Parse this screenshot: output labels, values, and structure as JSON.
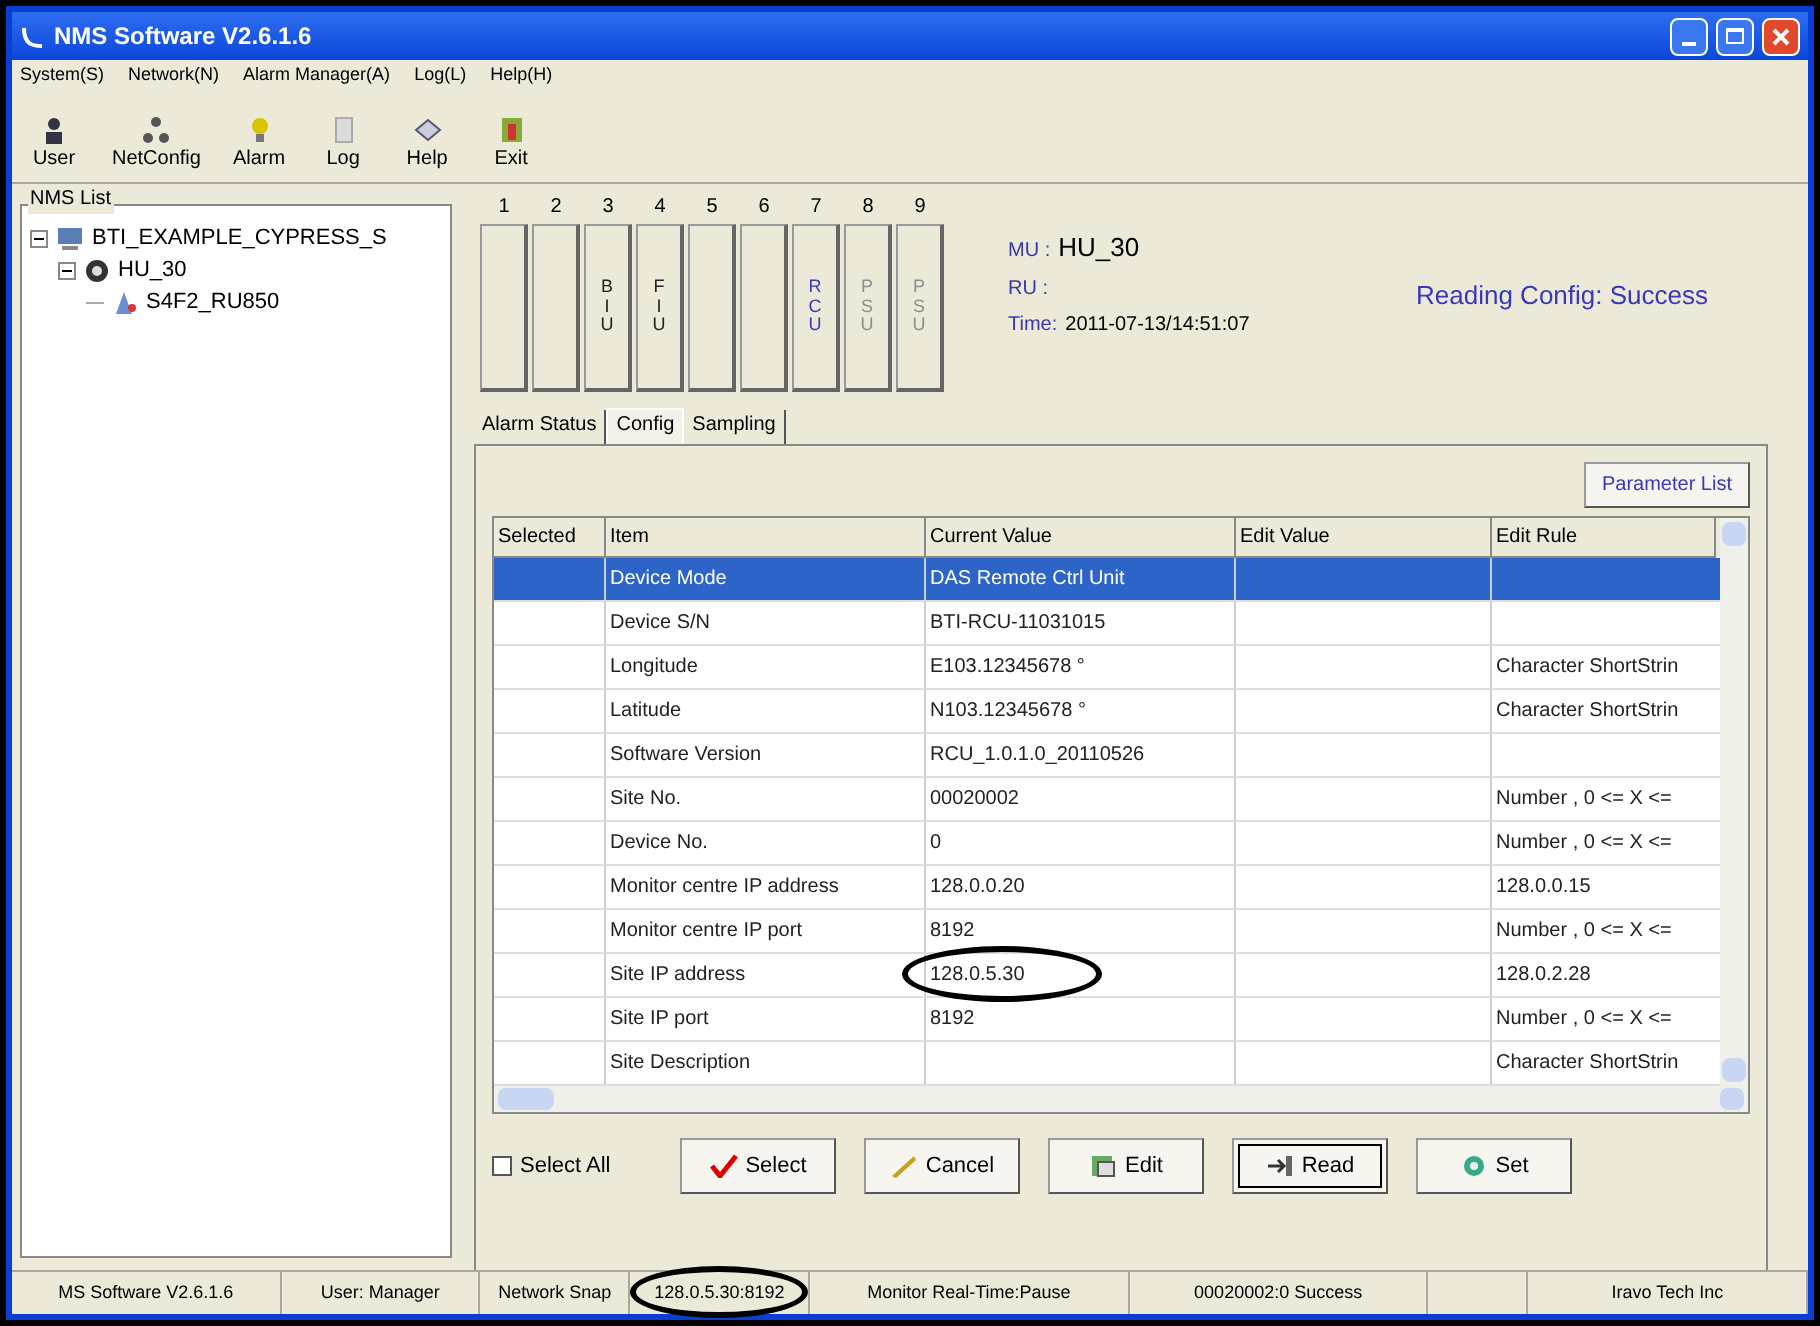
{
  "window": {
    "title": "NMS Software V2.6.1.6"
  },
  "menu": [
    "System(S)",
    "Network(N)",
    "Alarm Manager(A)",
    "Log(L)",
    "Help(H)"
  ],
  "toolbar": [
    {
      "label": "User",
      "kind": "user"
    },
    {
      "label": "NetConfig",
      "kind": "network"
    },
    {
      "label": "Alarm",
      "kind": "bulb"
    },
    {
      "label": "Log",
      "kind": "log"
    },
    {
      "label": "Help",
      "kind": "help"
    },
    {
      "label": "Exit",
      "kind": "exit"
    }
  ],
  "nms_list": {
    "title": "NMS List",
    "tree": [
      {
        "label": "BTI_EXAMPLE_CYPRESS_S",
        "kind": "computer",
        "expanded": true,
        "children": [
          {
            "label": "HU_30",
            "kind": "hub",
            "expanded": true,
            "children": [
              {
                "label": "S4F2_RU850",
                "kind": "remote"
              }
            ]
          }
        ]
      }
    ]
  },
  "slots": [
    {
      "number": "1",
      "kind": "normal"
    },
    {
      "number": "2",
      "kind": "normal"
    },
    {
      "number": "3",
      "label": "BIU",
      "kind": "normal"
    },
    {
      "number": "4",
      "label": "FIU",
      "kind": "normal"
    },
    {
      "number": "5",
      "kind": "normal"
    },
    {
      "number": "6",
      "kind": "normal"
    },
    {
      "number": "7",
      "label": "RCU",
      "kind": "active"
    },
    {
      "number": "8",
      "label": "PSU",
      "kind": "disabled"
    },
    {
      "number": "9",
      "label": "PSU",
      "kind": "disabled"
    }
  ],
  "info": {
    "mu_label": "MU :",
    "mu_value": "HU_30",
    "ru_label": "RU :",
    "time_label": "Time:",
    "time_value": "2011-07-13/14:51:07",
    "status": "Reading Config: Success"
  },
  "tabs": [
    {
      "label": "Alarm Status",
      "selected": false
    },
    {
      "label": "Config",
      "selected": true
    },
    {
      "label": "Sampling",
      "selected": false
    }
  ],
  "parameter_list_button": "Parameter List",
  "table": {
    "columns": [
      "Selected",
      "Item",
      "Current Value",
      "Edit Value",
      "Edit Rule"
    ],
    "rows": [
      {
        "item": "Device Mode",
        "current": "DAS Remote Ctrl Unit",
        "selected": true
      },
      {
        "item": "Device S/N",
        "current": "BTI-RCU-11031015",
        "selected": false
      },
      {
        "item": "Longitude",
        "current": "E103.12345678 °",
        "rule": "Character ShortStrin",
        "selected": false
      },
      {
        "item": "Latitude",
        "current": "N103.12345678 °",
        "rule": "Character ShortStrin",
        "selected": false
      },
      {
        "item": "Software Version",
        "current": "RCU_1.0.1.0_20110526",
        "selected": false
      },
      {
        "item": "Site No.",
        "current": "00020002",
        "rule": "Number , 0 <= X <=",
        "selected": false
      },
      {
        "item": "Device No.",
        "current": "0",
        "rule": "Number , 0 <= X <=",
        "selected": false
      },
      {
        "item": "Monitor centre IP address",
        "current": "128.0.0.20",
        "rule": "128.0.0.15",
        "selected": false
      },
      {
        "item": "Monitor centre IP port",
        "current": "8192",
        "rule": "Number , 0 <= X <=",
        "selected": false
      },
      {
        "item": "Site IP address",
        "current": "128.0.5.30",
        "rule": "128.0.2.28",
        "selected": false,
        "circled": true
      },
      {
        "item": "Site IP port",
        "current": "8192",
        "rule": "Number , 0 <= X <=",
        "selected": false
      },
      {
        "item": "Site Description",
        "rule": "Character ShortStrin",
        "selected": false
      }
    ]
  },
  "select_all": {
    "label": "Select All",
    "checked": false
  },
  "buttons": [
    {
      "label": "Select",
      "kind": "check"
    },
    {
      "label": "Cancel",
      "kind": "cancel"
    },
    {
      "label": "Edit",
      "kind": "edit"
    },
    {
      "label": "Read",
      "kind": "read"
    },
    {
      "label": "Set",
      "kind": "set"
    }
  ],
  "status_bar": [
    {
      "text": "MS Software V2.6.1.6",
      "circled": false
    },
    {
      "text": "User: Manager",
      "circled": false
    },
    {
      "text": "Network Snap",
      "circled": false
    },
    {
      "text": "128.0.5.30:8192",
      "circled": true
    },
    {
      "text": "Monitor Real-Time:Pause",
      "circled": false
    },
    {
      "text": "00020002:0 Success",
      "circled": false
    },
    {
      "circled": false
    },
    {
      "text": "Iravo Tech Inc",
      "circled": false
    }
  ]
}
